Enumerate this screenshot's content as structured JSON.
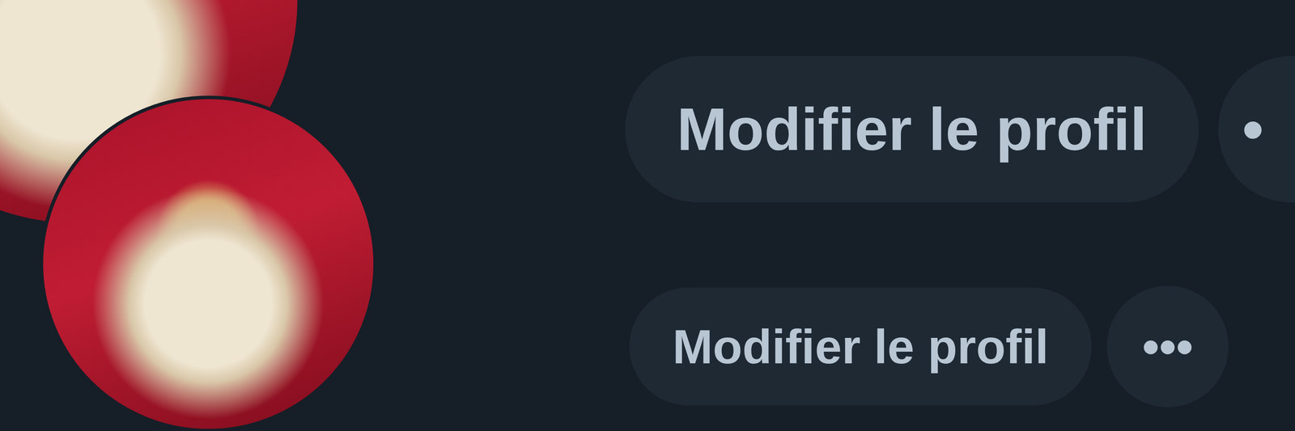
{
  "profile_headers": [
    {
      "kind": "large",
      "edit_button": "Modifier le profil",
      "more_button": "•"
    },
    {
      "kind": "compact",
      "edit_button": "Modifier le profil",
      "more_button": "•••"
    }
  ]
}
